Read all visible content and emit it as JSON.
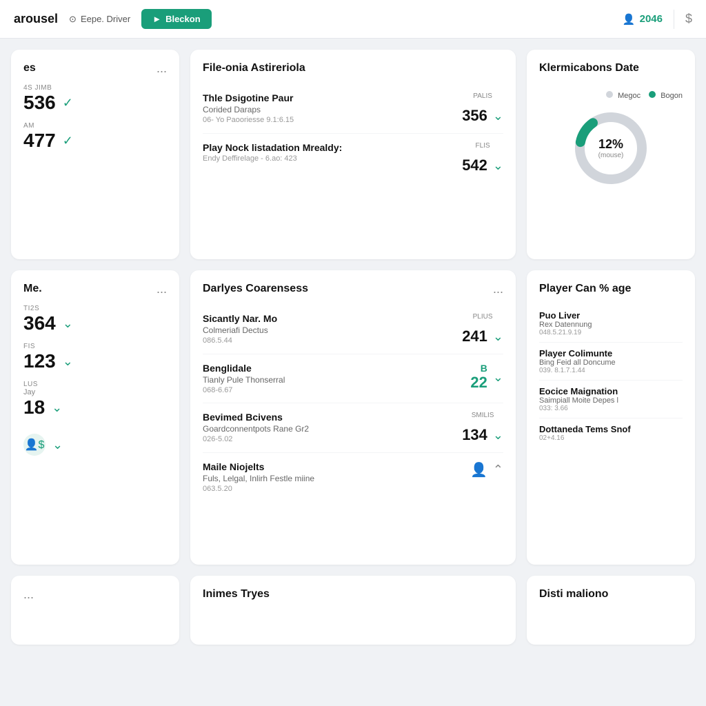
{
  "header": {
    "title": "arousel",
    "user_icon": "location-icon",
    "username": "Eepe. Driver",
    "btn_label": "Bleckon",
    "btn_icon": "arrow-right-icon",
    "count": "2046",
    "count_icon": "person-icon",
    "dollar_icon": "dollar-icon"
  },
  "left_top": {
    "title": "es",
    "dots": "...",
    "stats": [
      {
        "label": "4S JIMB",
        "value": "536"
      },
      {
        "label": "AM",
        "value": "477"
      }
    ]
  },
  "center_top": {
    "title": "File-onia Astireriola",
    "items": [
      {
        "name": "Thle Dsigotine Paur",
        "sub": "Corided Daraps",
        "code": "06- Yo Paooriesse  9.1:6.15",
        "val_label": "PALIS",
        "val": "356",
        "val_color": "normal"
      },
      {
        "name": "Play Nock listadation Mrealdy:",
        "sub": "",
        "code": "Endy Deffirelage - 6.ao: 423",
        "val_label": "FLIS",
        "val": "542",
        "val_color": "normal"
      }
    ]
  },
  "right_top": {
    "title": "Klermicabons Date",
    "legend": [
      {
        "label": "Megoc",
        "color": "#d1d5db"
      },
      {
        "label": "Bogon",
        "color": "#1a9e7a"
      }
    ],
    "donut": {
      "pct": "12%",
      "sub": "(mouse)",
      "green_pct": 12,
      "total": 100
    }
  },
  "left_mid": {
    "title": "Me.",
    "dots": "...",
    "stats": [
      {
        "label": "TI2S",
        "value": "364"
      },
      {
        "label": "FIS",
        "value": "123"
      },
      {
        "label": "LUS",
        "value": "18",
        "sub_label": "Jay"
      }
    ],
    "extra": {
      "icon": "person-dollar-icon"
    }
  },
  "center_mid": {
    "title": "Darlyes Coarensess",
    "dots": "...",
    "items": [
      {
        "name": "Sicantly Nar. Mo",
        "sub": "Colmeriafi Dectus",
        "code": "086.5.44",
        "val_label": "PLIUS",
        "val": "241",
        "val_color": "normal"
      },
      {
        "name": "Benglidale",
        "sub": "Tianly Pule Thonserral",
        "code": "068-6.67",
        "val_label": "",
        "val": "22",
        "val_top": "B",
        "val_color": "green"
      },
      {
        "name": "Bevimed Bcivens",
        "sub": "Goardconnentpots Rane Gr2",
        "code": "026-5.02",
        "val_label": "SMILIS",
        "val": "134",
        "val_color": "normal"
      },
      {
        "name": "Maile Niojelts",
        "sub": "Fuls, Lelgal, Inlirh Festle miine",
        "code": "063.5.20",
        "val_label": "",
        "val": "",
        "val_color": "normal",
        "has_person_icon": true,
        "expanded": true
      }
    ]
  },
  "right_mid": {
    "title": "Player Can % age",
    "items": [
      {
        "name": "Puo Liver",
        "sub": "Rex Datennung",
        "code": "048.5.21.9.19"
      },
      {
        "name": "Player Colimunte",
        "sub": "Bing Feid all Doncume",
        "code": "039. 8.1.7.1.44"
      },
      {
        "name": "Eocice Maignation",
        "sub": "Saimpiall Moite Depes l",
        "code": "033: 3.66"
      },
      {
        "name": "Dottaneda Tems Snof",
        "sub": "",
        "code": "02+4.16"
      }
    ]
  },
  "left_bottom": {
    "dots": "..."
  },
  "center_bottom": {
    "title": "Inimes Tryes"
  },
  "right_bottom": {
    "title": "Disti maliono"
  }
}
